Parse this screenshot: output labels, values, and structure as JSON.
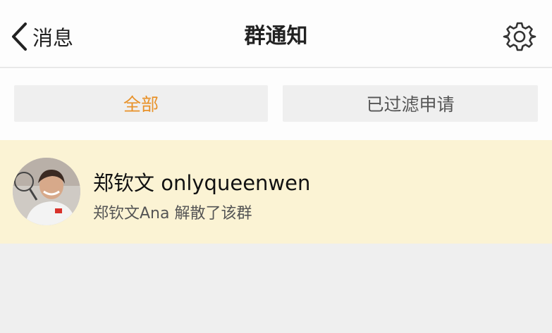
{
  "header": {
    "back_label": "消息",
    "title": "群通知",
    "back_icon": "chevron-left-icon",
    "settings_icon": "gear-icon"
  },
  "tabs": [
    {
      "label": "全部",
      "active": true
    },
    {
      "label": "已过滤申请",
      "active": false
    }
  ],
  "notices": [
    {
      "name": "郑钦文 onlyqueenwen",
      "message": "郑钦文Ana 解散了该群",
      "avatar_icon": "user-avatar-photo"
    }
  ],
  "colors": {
    "accent": "#e8922a",
    "notice_bg": "#fbf3d4",
    "page_bg": "#efefef"
  }
}
